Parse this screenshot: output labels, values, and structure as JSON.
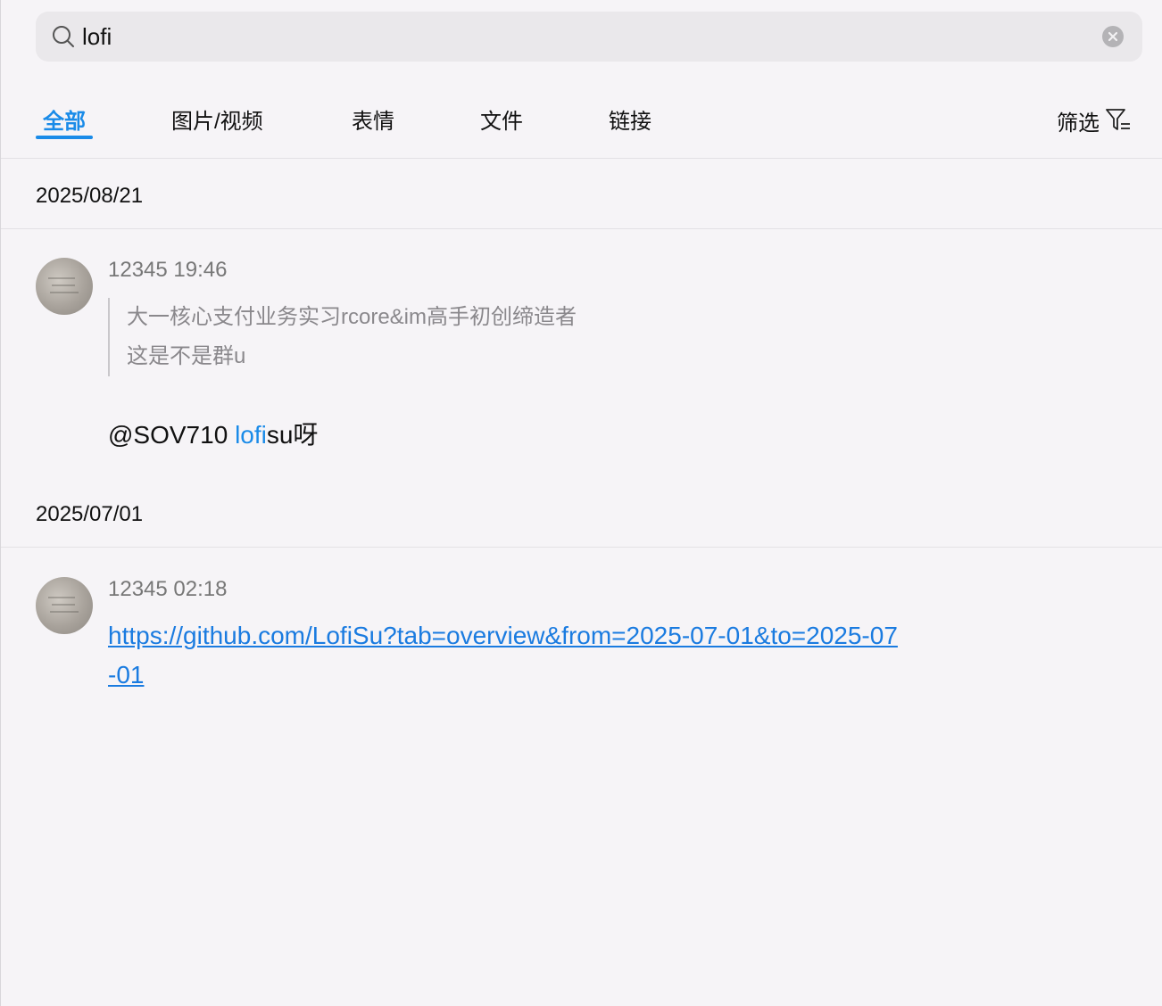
{
  "search": {
    "value": "lofi",
    "icon": "search-icon",
    "clear_icon": "clear-icon"
  },
  "tabs": [
    {
      "label": "全部",
      "active": true
    },
    {
      "label": "图片/视频",
      "active": false
    },
    {
      "label": "表情",
      "active": false
    },
    {
      "label": "文件",
      "active": false
    },
    {
      "label": "链接",
      "active": false
    }
  ],
  "filter": {
    "label": "筛选",
    "icon": "filter-icon"
  },
  "groups": [
    {
      "date": "2025/08/21",
      "message": {
        "sender": "12345",
        "time": "19:46",
        "quote_lines": [
          "大一核心支付业务实习rcore&im高手初创缔造者",
          "这是不是群u"
        ],
        "text_before": "@SOV710 ",
        "text_highlight": "lofi",
        "text_after": "su呀"
      }
    },
    {
      "date": "2025/07/01",
      "message": {
        "sender": "12345",
        "time": "02:18",
        "link_line1": "https://github.com/LofiSu?tab=overview&from=2025-07-01&to=2025-07",
        "link_line2": "-01"
      }
    }
  ],
  "colors": {
    "accent": "#1a8be8",
    "link": "#1a7be0",
    "background": "#f6f4f7"
  }
}
